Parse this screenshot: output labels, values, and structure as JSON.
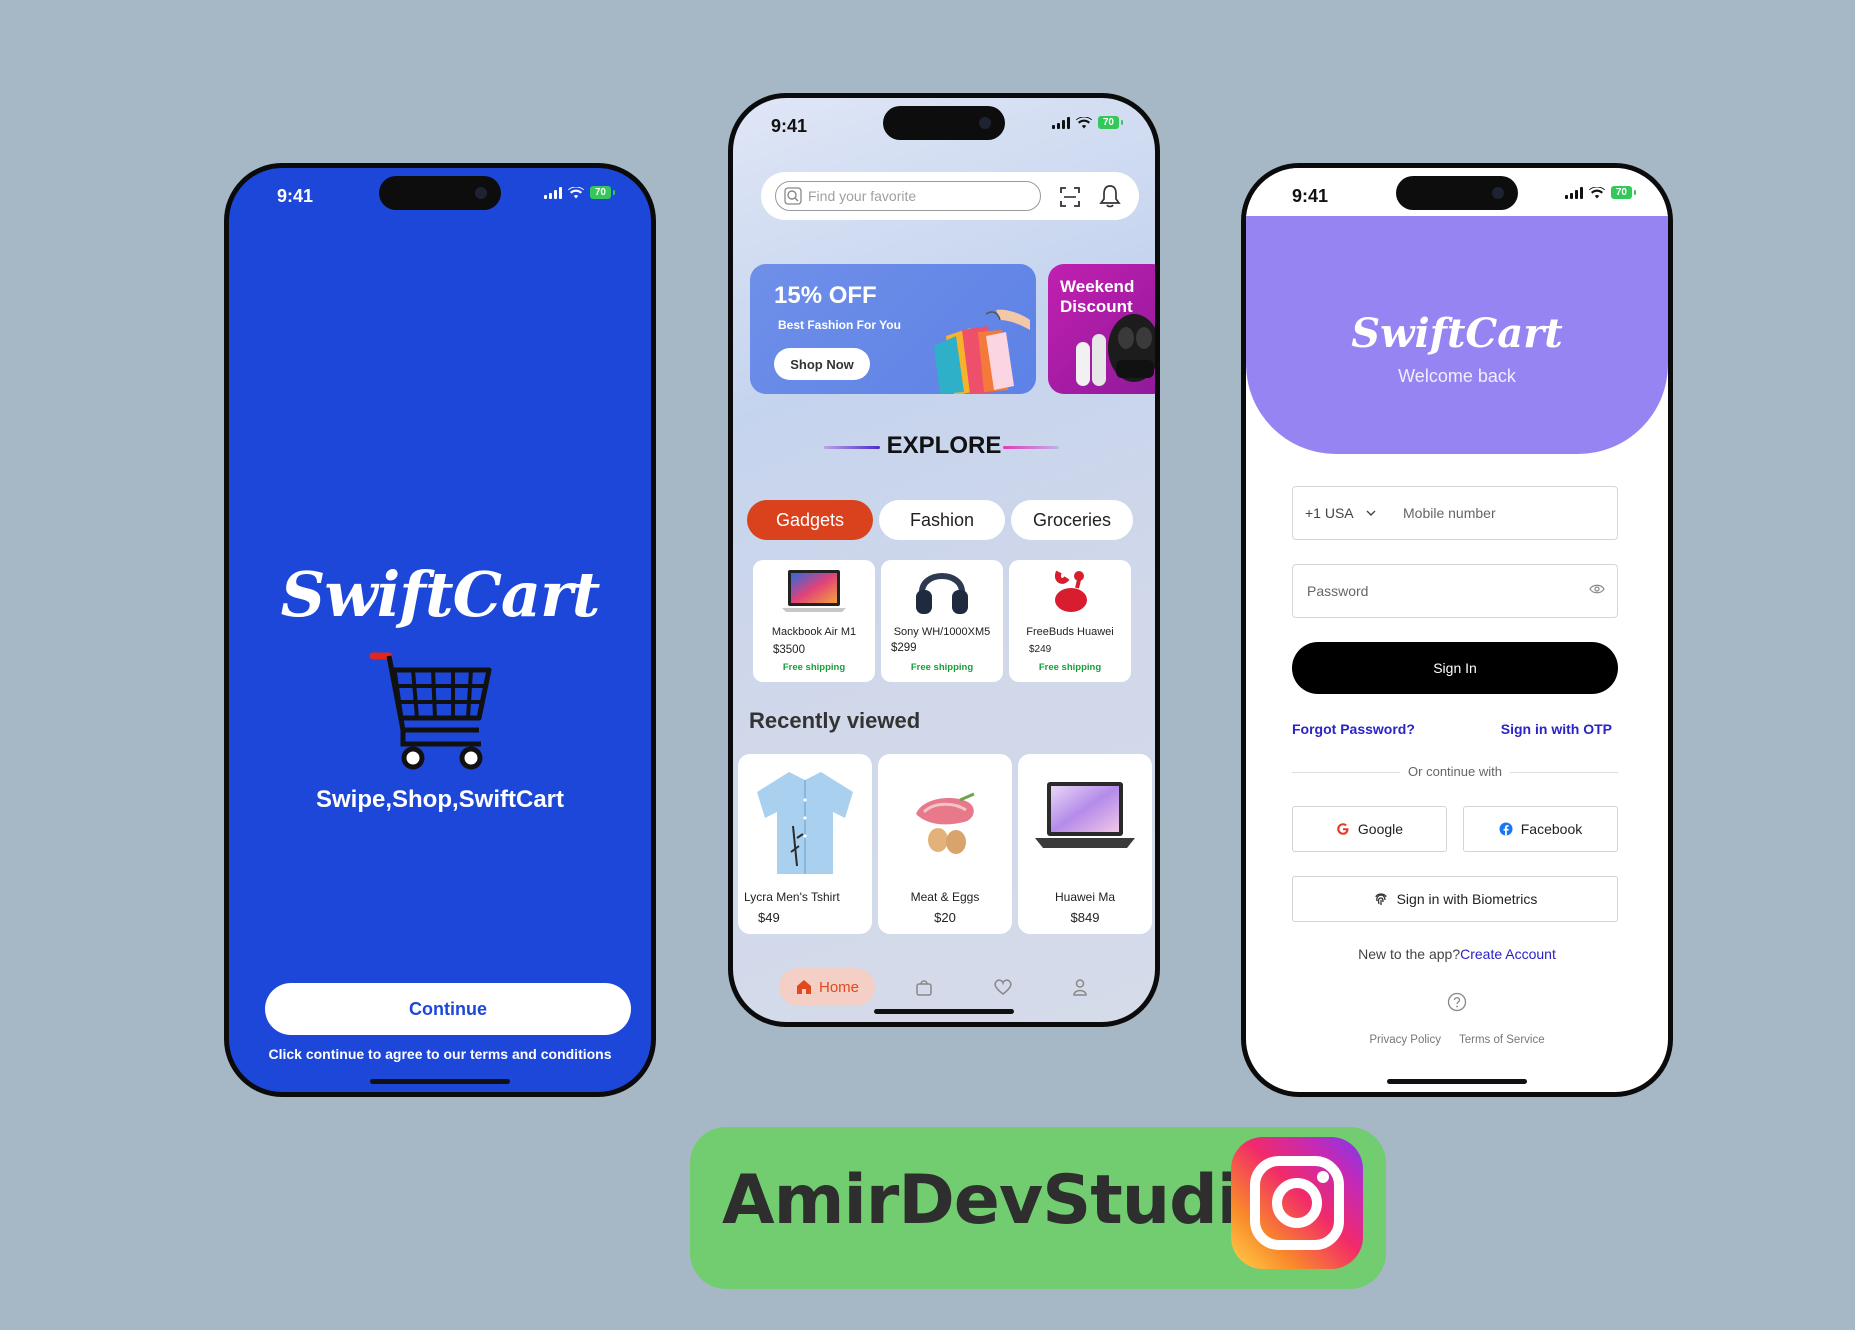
{
  "status": {
    "time": "9:41",
    "battery": "70"
  },
  "splash": {
    "brand": "SwiftCart",
    "tagline": "Swipe,Shop,SwiftCart",
    "continue_label": "Continue",
    "terms": "Click continue to agree to our terms and conditions",
    "colors": {
      "background": "#1c47d8",
      "cart_handle": "#e2261e"
    }
  },
  "home": {
    "search_placeholder": "Find your favorite",
    "banners": [
      {
        "title": "15% OFF",
        "subtitle": "Best Fashion For You",
        "button": "Shop Now"
      },
      {
        "title": "Weekend Discount"
      }
    ],
    "explore_title": "EXPLORE",
    "categories": [
      {
        "label": "Gadgets",
        "active": true
      },
      {
        "label": "Fashion",
        "active": false
      },
      {
        "label": "Groceries",
        "active": false
      }
    ],
    "products": [
      {
        "name": "Mackbook Air M1",
        "price": "$3500",
        "shipping": "Free shipping",
        "icon": "laptop-icon"
      },
      {
        "name": "Sony WH/1000XM5",
        "price": "$299",
        "shipping": "Free shipping",
        "icon": "headphones-icon"
      },
      {
        "name": "FreeBuds Huawei",
        "price": "$249",
        "shipping": "Free shipping",
        "icon": "earbuds-icon"
      }
    ],
    "recent_title": "Recently viewed",
    "recent": [
      {
        "name": "Lycra Men's Tshirt",
        "price": "$49",
        "icon": "shirt-icon"
      },
      {
        "name": "Meat & Eggs",
        "price": "$20",
        "icon": "food-icon"
      },
      {
        "name": "Huawei Ma",
        "price": "$849",
        "icon": "laptop-icon"
      }
    ],
    "tabs": {
      "home_label": "Home"
    },
    "colors": {
      "accent": "#d9421c"
    }
  },
  "login": {
    "brand": "SwiftCart",
    "welcome": "Welcome back",
    "country_code": "+1 USA",
    "mobile_placeholder": "Mobile number",
    "password_placeholder": "Password",
    "signin_label": "Sign In",
    "forgot": "Forgot Password?",
    "otp": "Sign in with OTP",
    "continue_with": "Or continue with",
    "google": "Google",
    "facebook": "Facebook",
    "biometrics": "Sign in with Biometrics",
    "new_to_app": "New to the app?",
    "create_account": "Create Account",
    "privacy": "Privacy Policy",
    "tos": "Terms of Service",
    "colors": {
      "header": "#9784f3",
      "link": "#2b22c7"
    }
  },
  "badge": {
    "text": "AmirDevStudio",
    "icon": "instagram-icon"
  }
}
